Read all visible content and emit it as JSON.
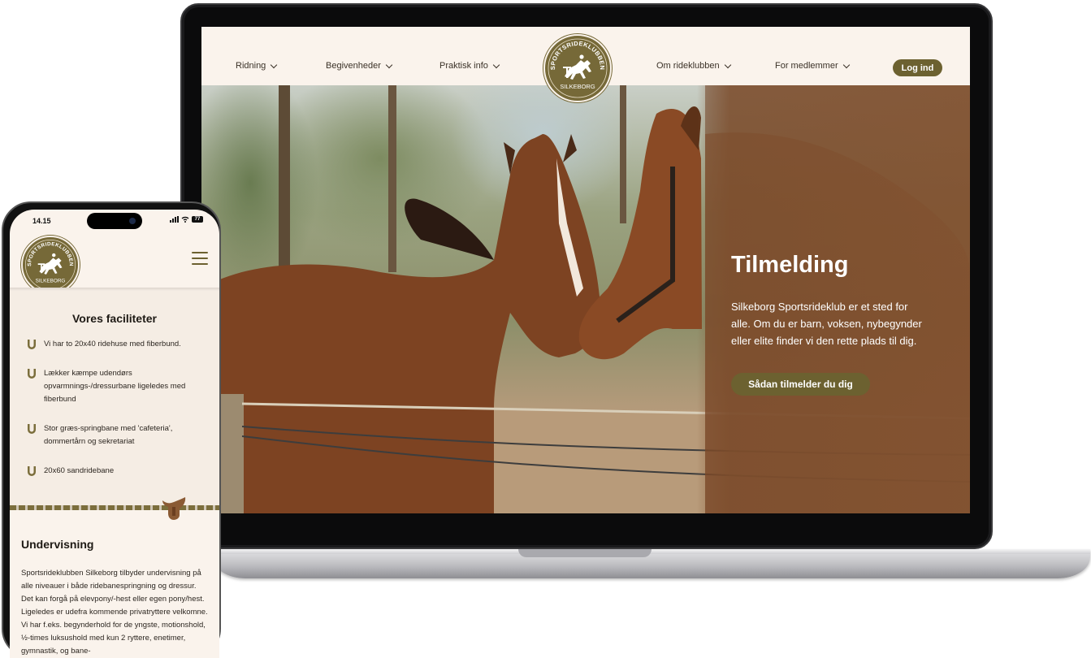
{
  "desktop": {
    "nav_left": [
      {
        "label": "Ridning"
      },
      {
        "label": "Begivenheder"
      },
      {
        "label": "Praktisk info"
      }
    ],
    "nav_right": [
      {
        "label": "Om rideklubben"
      },
      {
        "label": "For medlemmer"
      }
    ],
    "logo": {
      "arc_text": "SPORTSRIDEKLUBBEN",
      "bottom_text": "SILKEBORG"
    },
    "login_label": "Log ind",
    "hero": {
      "title": "Tilmelding",
      "text": "Silkeborg Sportsrideklub er et sted for alle. Om du er barn, voksen, nybegynder eller elite finder vi den rette plads til dig.",
      "cta_label": "Sådan tilmelder du dig"
    }
  },
  "mobile": {
    "status": {
      "time": "14.15",
      "battery": "77"
    },
    "logo": {
      "arc_text": "SPORTSRIDEKLUBBEN",
      "bottom_text": "SILKEBORG"
    },
    "facilities": {
      "title": "Vores faciliteter",
      "items": [
        "Vi har to 20x40 ridehuse med fiberbund.",
        "Lækker kæmpe udendørs opvarmnings-/dressurbane ligeledes med fiberbund",
        "Stor græs-springbane med 'cafeteria', dommertårn og sekretariat",
        "20x60 sandridebane"
      ]
    },
    "teaching": {
      "title": "Undervisning",
      "text": "Sportsrideklubben Silkeborg tilbyder undervisning på alle niveauer i både ridebanespringning og dressur. Det kan forgå på elevpony/-hest eller egen pony/hest. Ligeledes er udefra kommende privatryttere velkomne. Vi har f.eks. begynderhold for de yngste, motionshold, ½-times luksushold med kun 2 ryttere, enetimer, gymnastik, og bane-"
    }
  },
  "colors": {
    "brand": "#6c6130",
    "logo": "#766938",
    "page_bg": "#faf3ec",
    "text": "#1e1a15"
  }
}
